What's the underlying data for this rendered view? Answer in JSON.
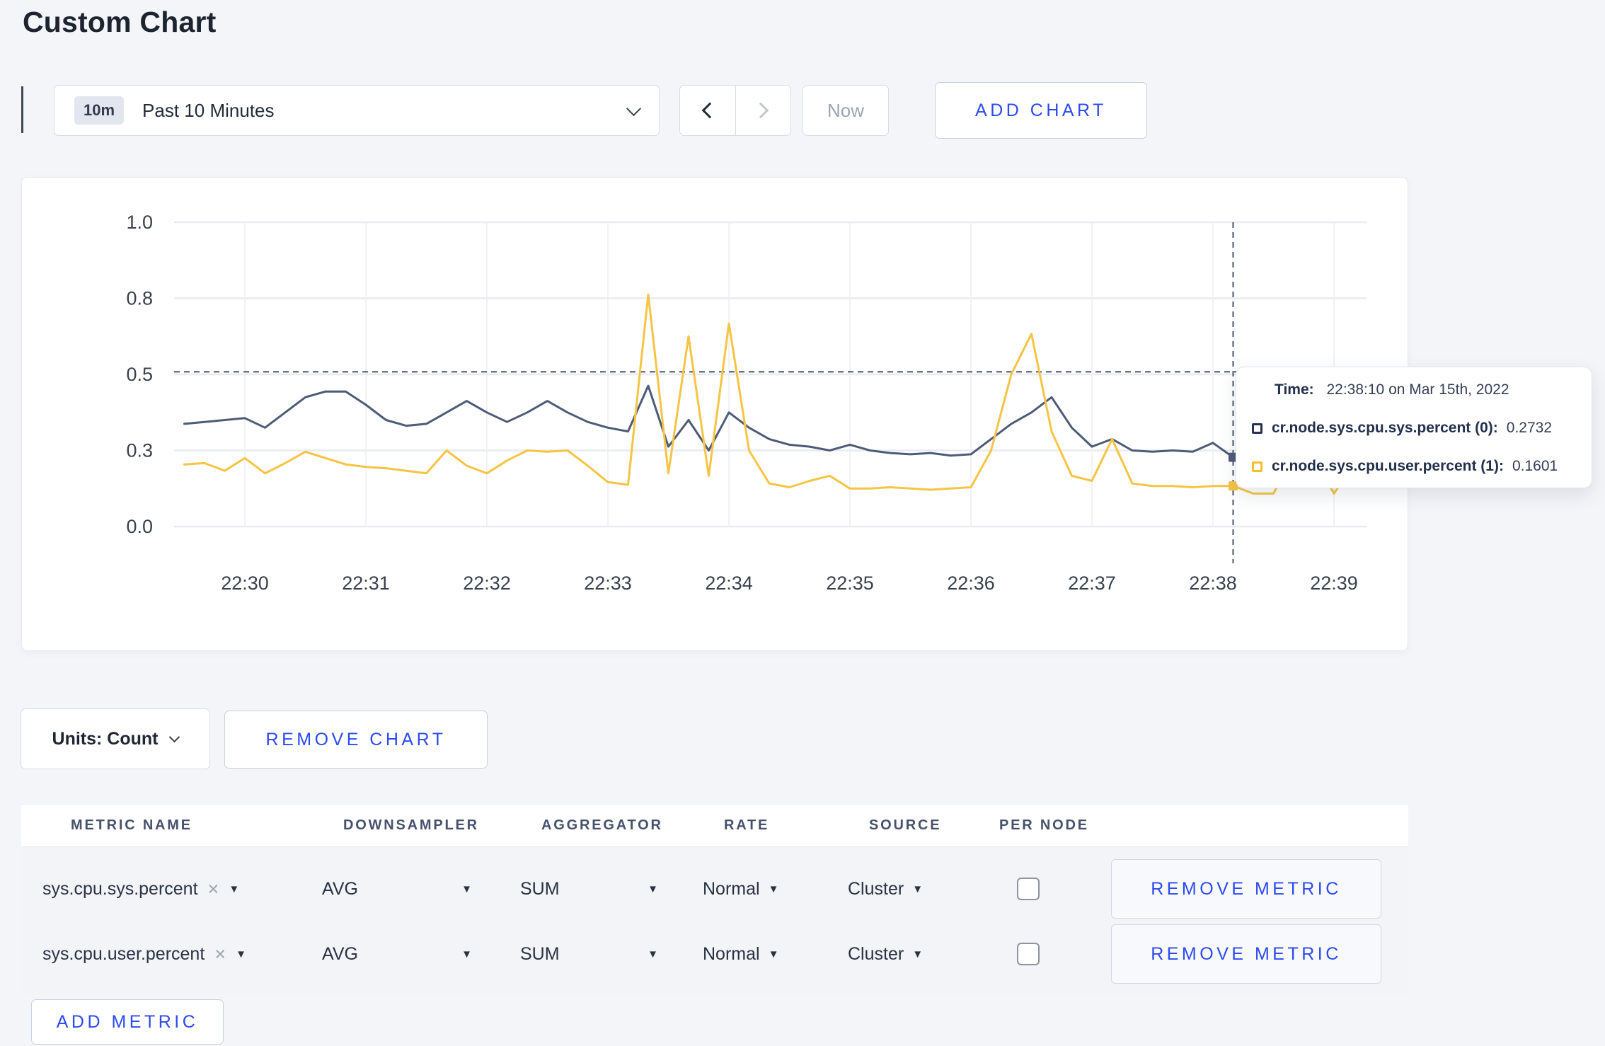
{
  "page": {
    "title": "Custom Chart",
    "background": "#f4f5f9",
    "accent_blue": "#2b4af0"
  },
  "toolbar": {
    "time_range_badge": "10m",
    "time_range_label": "Past 10 Minutes",
    "now_label": "Now",
    "add_chart_label": "ADD CHART"
  },
  "chart_data": {
    "type": "line",
    "title": "",
    "xlabel": "",
    "ylabel": "",
    "x_tick_labels": [
      "22:30",
      "22:31",
      "22:32",
      "22:33",
      "22:34",
      "22:35",
      "22:36",
      "22:37",
      "22:38",
      "22:39"
    ],
    "y_ticks": [
      {
        "label": "0.0",
        "value": 0
      },
      {
        "label": "0.3",
        "value": 0.3
      },
      {
        "label": "0.5",
        "value": 0.5
      },
      {
        "label": "0.8",
        "value": 0.8
      },
      {
        "label": "1.0",
        "value": 1.0
      }
    ],
    "grid": true,
    "legend_position": "tooltip",
    "start_offset_sec": -30,
    "step_sec": 10,
    "hline_value": 0.51,
    "crosshair": {
      "offset_sec": 490,
      "time_label": "22:38:10 on Mar 15th, 2022"
    },
    "series": [
      {
        "name": "cr.node.sys.cpu.sys.percent (0)",
        "color": "#4d5b77",
        "values": [
          0.37,
          0.375,
          0.38,
          0.385,
          0.36,
          0.4,
          0.44,
          0.455,
          0.455,
          0.42,
          0.38,
          0.365,
          0.37,
          0.4,
          0.43,
          0.4,
          0.375,
          0.4,
          0.43,
          0.4,
          0.375,
          0.36,
          0.35,
          0.47,
          0.31,
          0.38,
          0.3,
          0.4,
          0.36,
          0.33,
          0.315,
          0.31,
          0.3,
          0.315,
          0.3,
          0.29,
          0.285,
          0.29,
          0.28,
          0.285,
          0.33,
          0.37,
          0.4,
          0.44,
          0.36,
          0.31,
          0.33,
          0.3,
          0.295,
          0.3,
          0.295,
          0.32,
          0.2732,
          0.3,
          0.29,
          0.3,
          0.295,
          0.33,
          0.3
        ]
      },
      {
        "name": "cr.node.sys.cpu.user.percent (1)",
        "color": "#f6c444",
        "values": [
          0.245,
          0.25,
          0.22,
          0.27,
          0.21,
          0.25,
          0.295,
          0.27,
          0.245,
          0.235,
          0.23,
          0.22,
          0.21,
          0.3,
          0.24,
          0.21,
          0.26,
          0.3,
          0.295,
          0.3,
          0.24,
          0.175,
          0.165,
          0.81,
          0.21,
          0.65,
          0.2,
          0.7,
          0.3,
          0.17,
          0.155,
          0.18,
          0.2,
          0.15,
          0.15,
          0.155,
          0.15,
          0.145,
          0.15,
          0.155,
          0.3,
          0.5,
          0.66,
          0.35,
          0.2,
          0.18,
          0.33,
          0.17,
          0.16,
          0.16,
          0.155,
          0.16,
          0.1601,
          0.13,
          0.13,
          0.28,
          0.27,
          0.13,
          0.25
        ]
      }
    ]
  },
  "tooltip": {
    "time_label": "Time:",
    "time_value": "22:38:10 on Mar 15th, 2022",
    "rows": [
      {
        "label": "cr.node.sys.cpu.sys.percent (0):",
        "value": "0.2732",
        "color": "#243352"
      },
      {
        "label": "cr.node.sys.cpu.user.percent (1):",
        "value": "0.1601",
        "color": "#f5bf2a"
      }
    ]
  },
  "chart_footer": {
    "units_label": "Units: Count",
    "remove_chart_label": "REMOVE CHART"
  },
  "metrics_table": {
    "headers": [
      "METRIC NAME",
      "DOWNSAMPLER",
      "AGGREGATOR",
      "RATE",
      "SOURCE",
      "PER NODE"
    ],
    "rows": [
      {
        "metric": "sys.cpu.sys.percent",
        "downsampler": "AVG",
        "aggregator": "SUM",
        "rate": "Normal",
        "source": "Cluster",
        "per_node_checked": false,
        "remove_label": "REMOVE METRIC"
      },
      {
        "metric": "sys.cpu.user.percent",
        "downsampler": "AVG",
        "aggregator": "SUM",
        "rate": "Normal",
        "source": "Cluster",
        "per_node_checked": false,
        "remove_label": "REMOVE METRIC"
      }
    ],
    "add_metric_label": "ADD METRIC"
  },
  "glyphs": {
    "close": "×",
    "caret": "▼"
  }
}
